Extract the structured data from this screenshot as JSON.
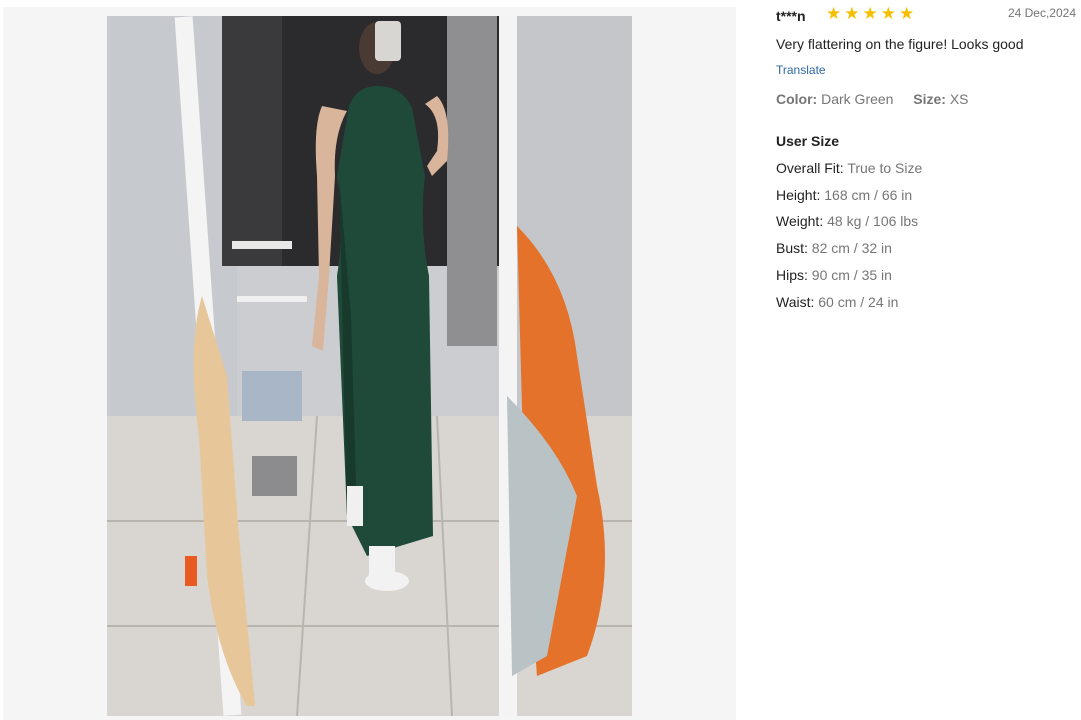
{
  "review": {
    "username": "t***n",
    "rating": 5,
    "date": "24 Dec,2024",
    "text": "Very flattering on the figure! Looks good",
    "translate_label": "Translate",
    "color_label": "Color:",
    "color_value": "Dark Green",
    "size_label": "Size:",
    "size_value": "XS"
  },
  "user_size": {
    "title": "User Size",
    "rows": [
      {
        "label": "Overall Fit:",
        "value": "True to Size"
      },
      {
        "label": "Height:",
        "value": "168 cm / 66 in"
      },
      {
        "label": "Weight:",
        "value": "48 kg / 106 lbs"
      },
      {
        "label": "Bust:",
        "value": "82 cm / 32 in"
      },
      {
        "label": "Hips:",
        "value": "90 cm / 35 in"
      },
      {
        "label": "Waist:",
        "value": "60 cm / 24 in"
      }
    ]
  },
  "colors": {
    "star": "#f6c000",
    "dress": "#1f4a3a",
    "towel_orange": "#e4722a"
  }
}
